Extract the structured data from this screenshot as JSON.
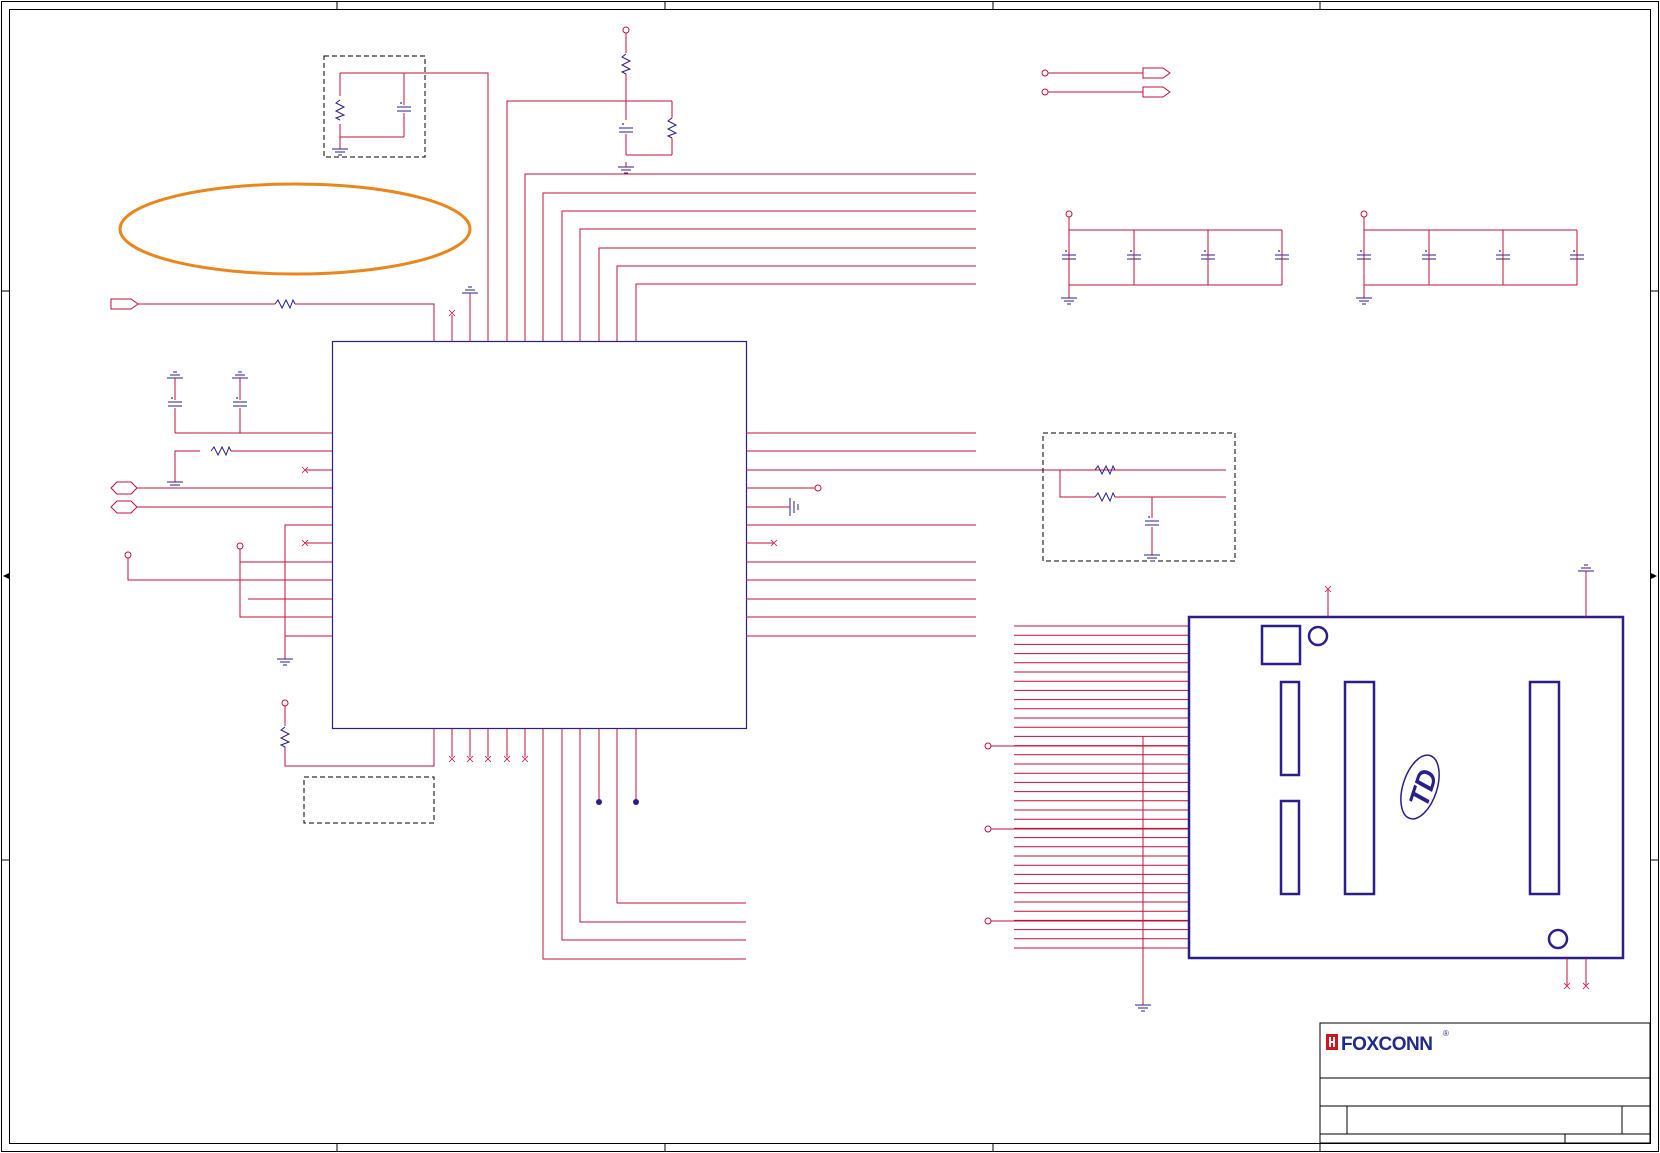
{
  "title_block": {
    "company": "FOXCONN",
    "registered_mark": "®"
  },
  "module": {
    "badge_text": "TD"
  },
  "colors": {
    "wire": "#c0103a",
    "part": "#2a1f8a",
    "frame": "#000000",
    "annotation": "#e8871e",
    "dashed_box": "#000000",
    "logo_red": "#d2141e",
    "logo_blue": "#1f2a8c"
  },
  "icons": {
    "ground": "ground-icon",
    "resistor": "resistor-icon",
    "capacitor": "capacitor-icon",
    "power_rail": "power-rail-icon",
    "port": "offpage-port-icon",
    "no_connect": "no-connect-icon",
    "junction": "junction-icon",
    "zone_arrow": "zone-arrow-icon"
  }
}
